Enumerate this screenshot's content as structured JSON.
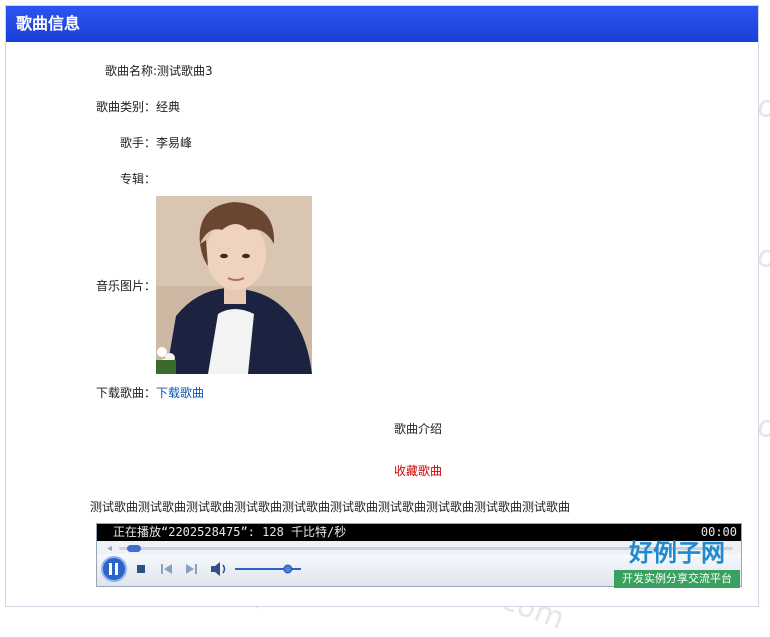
{
  "header": {
    "title": "歌曲信息"
  },
  "song": {
    "name_label": "歌曲名称:",
    "name_value": "测试歌曲3",
    "category_label": "歌曲类别：",
    "category_value": "经典",
    "singer_label": "歌手：",
    "singer_value": "李易峰",
    "album_label": "专辑：",
    "album_value": "",
    "picture_label": "音乐图片：",
    "download_label": "下载歌曲：",
    "download_link": "下载歌曲"
  },
  "intro": {
    "heading": "歌曲介绍",
    "favorite_link": "收藏歌曲",
    "text": "测试歌曲测试歌曲测试歌曲测试歌曲测试歌曲测试歌曲测试歌曲测试歌曲测试歌曲测试歌曲"
  },
  "player": {
    "status": "正在播放“2202528475”: 128 千比特/秒",
    "time": "00:00",
    "progress": 0.0,
    "volume": 0.8
  },
  "watermark": {
    "text": "www.haolizi.com"
  },
  "logo": {
    "line1": "好例子网",
    "line2": "开发实例分享交流平台"
  },
  "colors": {
    "header": "#1f46e0",
    "link": "#0a57b8",
    "favorite": "#d40000"
  }
}
